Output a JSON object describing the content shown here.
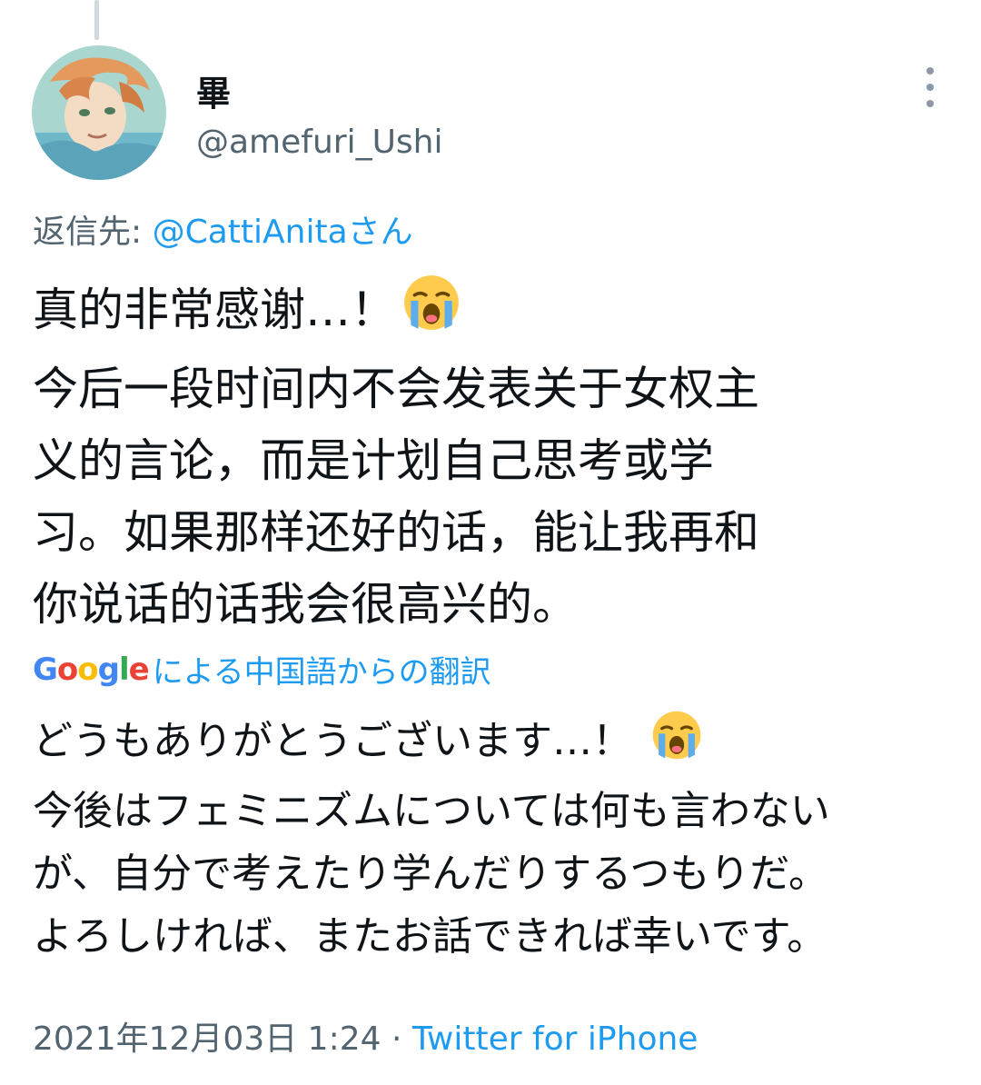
{
  "author": {
    "display_name": "畢",
    "handle": "@amefuri_Ushi"
  },
  "reply": {
    "prefix": "返信先:",
    "mention": "@CattiAnitaさん"
  },
  "tweet": {
    "lines": [
      "真的非常感谢…！",
      "今后一段时间内不会发表关于女权主",
      "义的言论，而是计划自己思考或学",
      "习。如果那样还好的话，能让我再和",
      "你说话的话我会很高兴的。"
    ]
  },
  "translation": {
    "logo": [
      "G",
      "o",
      "o",
      "g",
      "l",
      "e"
    ],
    "label": "による中国語からの翻訳",
    "lines": [
      "どうもありがとうございます…！",
      "今後はフェミニズムについては何も言わない",
      "が、自分で考えたり学んだりするつもりだ。",
      "よろしければ、またお話できれば幸いです。"
    ]
  },
  "meta": {
    "timestamp": "2021年12月03日 1:24",
    "separator": " · ",
    "client": "Twitter for iPhone"
  },
  "icons": {
    "more": "more-options-icon",
    "emoji": "loudly-crying-face-emoji"
  },
  "colors": {
    "link": "#1d9bf0",
    "secondary_text": "#536471",
    "primary_text": "#0f1419"
  }
}
